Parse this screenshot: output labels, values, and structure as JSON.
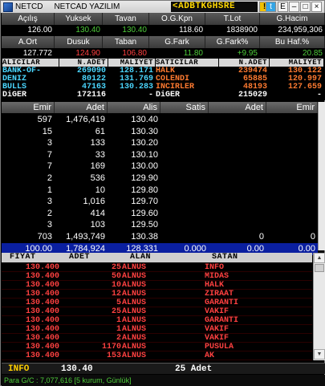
{
  "window": {
    "title_short": "NETCD",
    "title": "NETCAD YAZILIM",
    "ticker": "<ADBTKGHSRE"
  },
  "titlebar_icons": {
    "e": "E",
    "min": "–",
    "max": "□",
    "close": "×"
  },
  "stats_row1": [
    {
      "label": "Açılış",
      "value": "126.00",
      "color": "white"
    },
    {
      "label": "Yuksek",
      "value": "130.40",
      "color": "green"
    },
    {
      "label": "Tavan",
      "value": "130.40",
      "color": "green"
    },
    {
      "label": "O.G.Kpn",
      "value": "118.60",
      "color": "white"
    },
    {
      "label": "T.Lot",
      "value": "1838900",
      "color": "white"
    },
    {
      "label": "G.Hacim",
      "value": "234,959,306",
      "color": "white"
    }
  ],
  "stats_row2": [
    {
      "label": "A.Ort",
      "value": "127.772",
      "color": "white"
    },
    {
      "label": "Dusuk",
      "value": "124.90",
      "color": "red"
    },
    {
      "label": "Taban",
      "value": "106.80",
      "color": "red"
    },
    {
      "label": "G.Fark",
      "value": "11.80",
      "color": "green"
    },
    {
      "label": "G.Fark%",
      "value": "+9.95",
      "color": "green"
    },
    {
      "label": "Bu Haf.%",
      "value": "20.85",
      "color": "green"
    }
  ],
  "broker": {
    "headers": [
      "ALICILAR",
      "N.ADET",
      "MALIYET",
      "SATICILAR",
      "N.ADET",
      "MALIYET"
    ],
    "rows": [
      {
        "buyer": "BANK-OF-",
        "b_qty": "269090",
        "b_cost": "128.171",
        "seller": "HALK",
        "s_qty": "239474",
        "s_cost": "130.122"
      },
      {
        "buyer": "DENIZ",
        "b_qty": "80122",
        "b_cost": "131.769",
        "seller": "COLENDI",
        "s_qty": "65885",
        "s_cost": "120.997"
      },
      {
        "buyer": "BULLS",
        "b_qty": "47163",
        "b_cost": "130.283",
        "seller": "INCIRLER",
        "s_qty": "48193",
        "s_cost": "127.659"
      },
      {
        "buyer": "DiGER",
        "b_qty": "172116",
        "b_cost": "-",
        "seller": "DiGER",
        "s_qty": "215029",
        "s_cost": "-"
      }
    ]
  },
  "depth": {
    "headers": [
      "Emir",
      "Adet",
      "Alis",
      "Satis",
      "Adet",
      "Emir"
    ],
    "rows": [
      {
        "emir": "597",
        "adet": "1,476,419",
        "alis": "130.40"
      },
      {
        "emir": "15",
        "adet": "61",
        "alis": "130.30"
      },
      {
        "emir": "3",
        "adet": "133",
        "alis": "130.20"
      },
      {
        "emir": "7",
        "adet": "33",
        "alis": "130.10"
      },
      {
        "emir": "7",
        "adet": "169",
        "alis": "130.00"
      },
      {
        "emir": "2",
        "adet": "536",
        "alis": "129.90"
      },
      {
        "emir": "1",
        "adet": "10",
        "alis": "129.80"
      },
      {
        "emir": "3",
        "adet": "1,016",
        "alis": "129.70"
      },
      {
        "emir": "2",
        "adet": "414",
        "alis": "129.60"
      },
      {
        "emir": "3",
        "adet": "103",
        "alis": "129.50"
      }
    ],
    "subtotal": {
      "emir": "703",
      "adet": "1,493,749",
      "alis": "130.38",
      "satis": "",
      "s_adet": "0",
      "s_emir": "0"
    },
    "total": {
      "emir": "100.00",
      "adet": "1,784,924",
      "alis": "128.331",
      "satis": "0.000",
      "s_adet": "0.00",
      "s_emir": "0.00"
    }
  },
  "trades": {
    "headers": [
      "FIYAT",
      "ADET",
      "ALAN",
      "SATAN"
    ],
    "rows": [
      {
        "price": "130.400",
        "qty": "25",
        "buyer": "ALNUS",
        "seller": "INFO"
      },
      {
        "price": "130.400",
        "qty": "50",
        "buyer": "ALNUS",
        "seller": "MIDAS"
      },
      {
        "price": "130.400",
        "qty": "10",
        "buyer": "ALNUS",
        "seller": "HALK"
      },
      {
        "price": "130.400",
        "qty": "12",
        "buyer": "ALNUS",
        "seller": "ZIRAAT"
      },
      {
        "price": "130.400",
        "qty": "5",
        "buyer": "ALNUS",
        "seller": "GARANTI"
      },
      {
        "price": "130.400",
        "qty": "25",
        "buyer": "ALNUS",
        "seller": "VAKIF"
      },
      {
        "price": "130.400",
        "qty": "1",
        "buyer": "ALNUS",
        "seller": "GARANTI"
      },
      {
        "price": "130.400",
        "qty": "1",
        "buyer": "ALNUS",
        "seller": "VAKIF"
      },
      {
        "price": "130.400",
        "qty": "2",
        "buyer": "ALNUS",
        "seller": "VAKIF"
      },
      {
        "price": "130.400",
        "qty": "1170",
        "buyer": "ALNUS",
        "seller": "PUSULA"
      },
      {
        "price": "130.400",
        "qty": "153",
        "buyer": "ALNUS",
        "seller": "AK"
      }
    ]
  },
  "summary": {
    "broker": "INFO",
    "price": "130.40",
    "qty": "25 Adet"
  },
  "status": "Para G/C : 7,077,616 [5 kurum, Günlük]",
  "colors": {
    "up": "#4ecb3a",
    "down": "#ff4040",
    "ticker": "#ffd800",
    "broker_buy": "#4ad6ff",
    "broker_sell": "#ff7a30",
    "total_row": "#0a1fa0"
  }
}
